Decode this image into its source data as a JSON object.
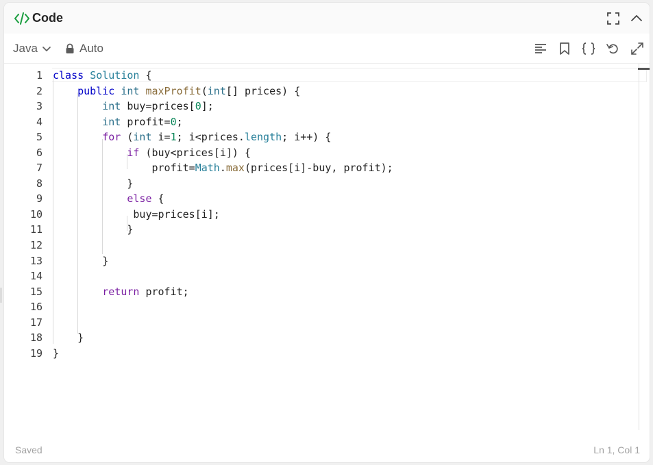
{
  "panel": {
    "title": "Code",
    "code_icon": "code-brackets-icon",
    "fullscreen_icon": "fullscreen-icon",
    "collapse_icon": "chevron-up-icon"
  },
  "toolbar": {
    "language": "Java",
    "mode": "Auto",
    "icons": [
      "format-icon",
      "bookmark-icon",
      "braces-icon",
      "undo-icon",
      "expand-icon"
    ]
  },
  "editor": {
    "line_numbers": [
      "1",
      "2",
      "3",
      "4",
      "5",
      "6",
      "7",
      "8",
      "9",
      "10",
      "11",
      "12",
      "13",
      "14",
      "15",
      "16",
      "17",
      "18",
      "19"
    ],
    "lines": [
      "class Solution {",
      "    public int maxProfit(int[] prices) {",
      "        int buy=prices[0];",
      "        int profit=0;",
      "        for (int i=1; i<prices.length; i++) {",
      "            if (buy<prices[i]) {",
      "                profit=Math.max(prices[i]-buy, profit);",
      "            }",
      "            else {",
      "             buy=prices[i];",
      "            }",
      "",
      "        }",
      "",
      "        return profit;",
      "",
      "",
      "    }",
      "}"
    ]
  },
  "status": {
    "saved": "Saved",
    "cursor": "Ln 1, Col 1"
  },
  "colors": {
    "keyword": "#7a1fa2",
    "keyword_blue": "#0000c8",
    "type": "#2b6f8a",
    "number": "#098658",
    "accent_green": "#1a9e3f"
  }
}
